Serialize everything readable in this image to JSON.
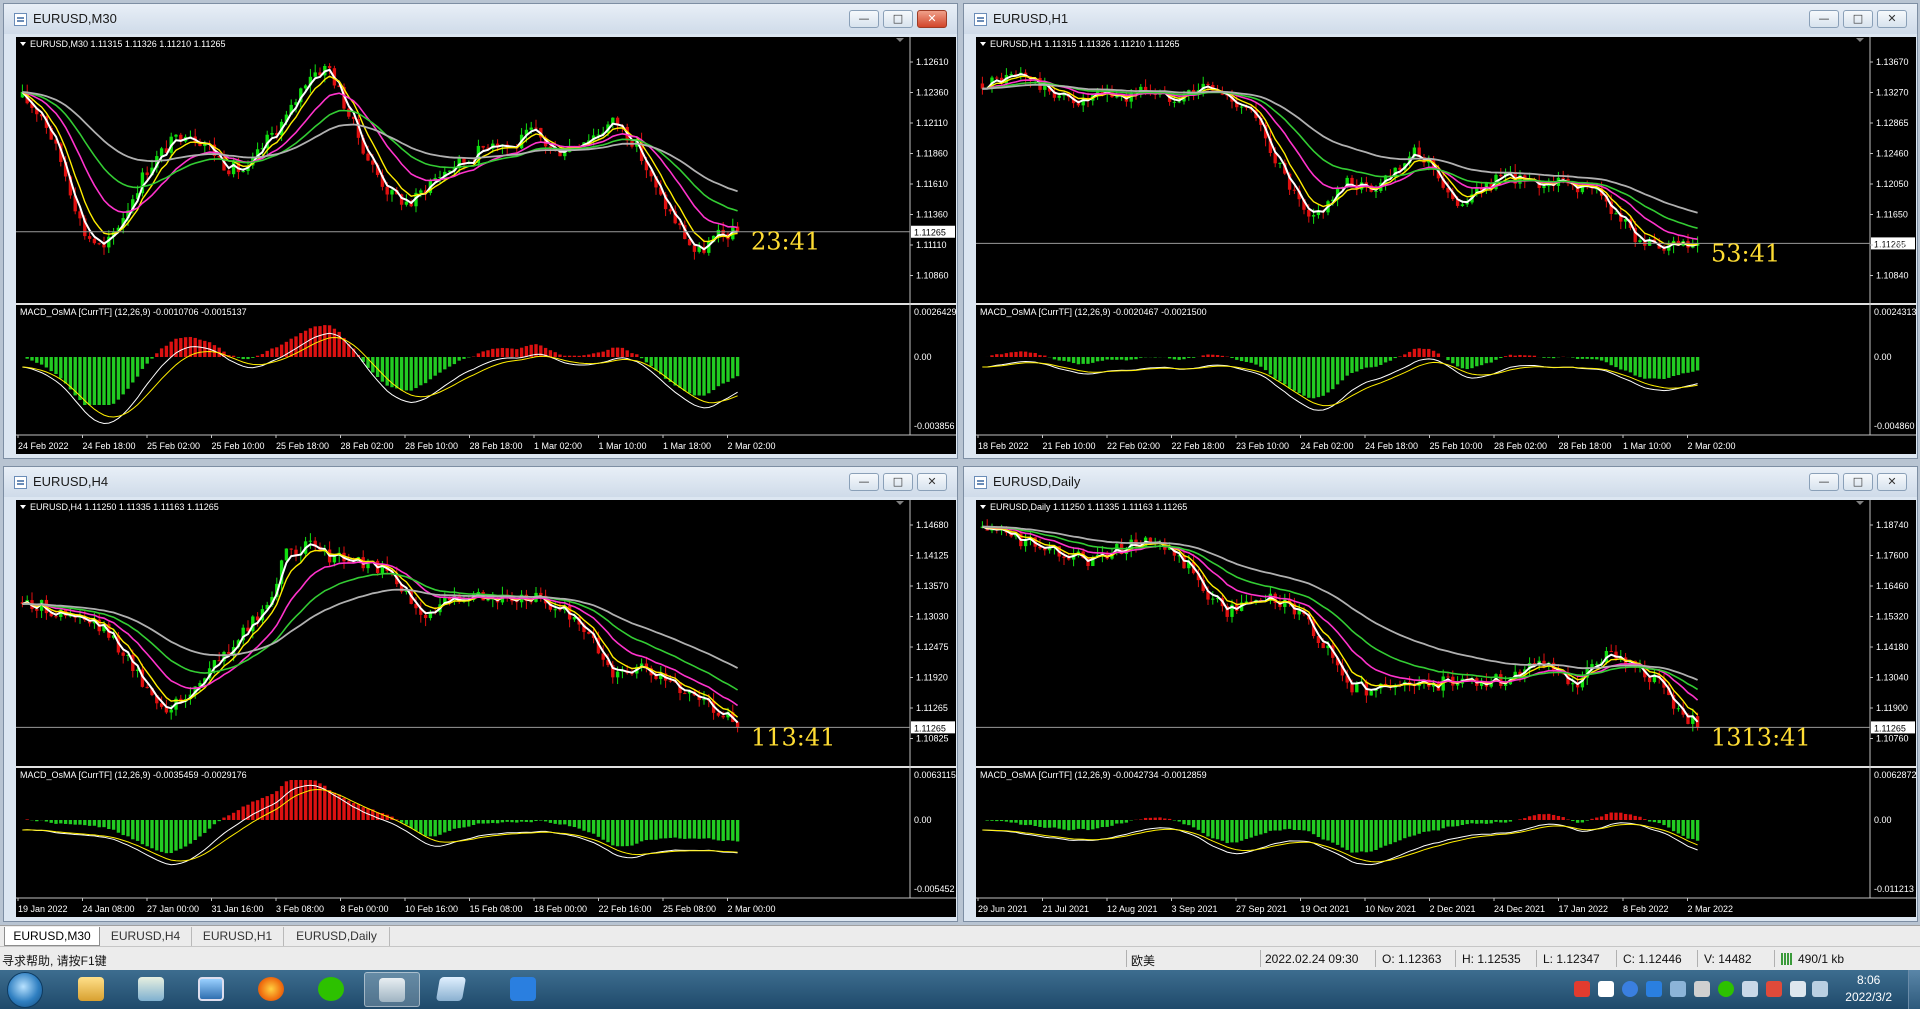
{
  "charts": [
    {
      "key": "m30",
      "title": "EURUSD,M30",
      "ohlc": "EURUSD,M30  1.11315 1.11326 1.11210 1.11265",
      "price_labels": [
        "1.12610",
        "1.12360",
        "1.12110",
        "1.11860",
        "1.11610",
        "1.11360",
        "1.11110",
        "1.10860"
      ],
      "current_price": "1.11265",
      "countdown": "23:41",
      "indicator": "MACD_OsMA [CurrTF] (12,26,9) -0.0010706 -0.0015137",
      "ind_labels": [
        "0.0026429",
        "0.00",
        "-0.003856"
      ],
      "time_labels": [
        "24 Feb 2022",
        "24 Feb 18:00",
        "25 Feb 02:00",
        "25 Feb 10:00",
        "25 Feb 18:00",
        "28 Feb 02:00",
        "28 Feb 10:00",
        "28 Feb 18:00",
        "1 Mar 02:00",
        "1 Mar 10:00",
        "1 Mar 18:00",
        "2 Mar 02:00"
      ],
      "close_series": [
        0.8,
        0.72,
        0.5,
        0.22,
        0.14,
        0.3,
        0.48,
        0.58,
        0.66,
        0.6,
        0.5,
        0.48,
        0.62,
        0.72,
        0.9,
        0.93,
        0.72,
        0.52,
        0.38,
        0.34,
        0.44,
        0.5,
        0.54,
        0.62,
        0.58,
        0.66,
        0.56,
        0.6,
        0.64,
        0.7,
        0.6,
        0.4,
        0.26,
        0.12,
        0.2,
        0.22
      ]
    },
    {
      "key": "h1",
      "title": "EURUSD,H1",
      "ohlc": "EURUSD,H1  1.11315 1.11326 1.11210 1.11265",
      "price_labels": [
        "1.13670",
        "1.13270",
        "1.12865",
        "1.12460",
        "1.12050",
        "1.11650",
        "1.11245",
        "1.10840"
      ],
      "current_price": "1.11265",
      "countdown": "53:41",
      "indicator": "MACD_OsMA [CurrTF] (12,26,9) -0.0020467 -0.0021500",
      "ind_labels": [
        "0.0024313",
        "0.00",
        "-0.004860"
      ],
      "time_labels": [
        "18 Feb 2022",
        "21 Feb 10:00",
        "22 Feb 02:00",
        "22 Feb 18:00",
        "23 Feb 10:00",
        "24 Feb 02:00",
        "24 Feb 18:00",
        "25 Feb 10:00",
        "28 Feb 02:00",
        "28 Feb 18:00",
        "1 Mar 10:00",
        "2 Mar 02:00"
      ],
      "close_series": [
        0.86,
        0.88,
        0.9,
        0.84,
        0.8,
        0.78,
        0.82,
        0.8,
        0.84,
        0.8,
        0.82,
        0.85,
        0.8,
        0.76,
        0.6,
        0.42,
        0.26,
        0.36,
        0.44,
        0.4,
        0.48,
        0.56,
        0.52,
        0.34,
        0.38,
        0.44,
        0.46,
        0.42,
        0.44,
        0.42,
        0.4,
        0.3,
        0.2,
        0.14,
        0.16,
        0.15
      ]
    },
    {
      "key": "h4",
      "title": "EURUSD,H4",
      "ohlc": "EURUSD,H4  1.11250 1.11335 1.11163 1.11265",
      "price_labels": [
        "1.14680",
        "1.14125",
        "1.13570",
        "1.13030",
        "1.12475",
        "1.11920",
        "1.11265",
        "1.10825"
      ],
      "current_price": "1.11265",
      "countdown": "113:41",
      "indicator": "MACD_OsMA [CurrTF] (12,26,9) -0.0035459 -0.0029176",
      "ind_labels": [
        "0.0063115",
        "0.00",
        "-0.005452"
      ],
      "time_labels": [
        "19 Jan 2022",
        "24 Jan 08:00",
        "27 Jan 00:00",
        "31 Jan 16:00",
        "3 Feb 08:00",
        "8 Feb 00:00",
        "10 Feb 16:00",
        "15 Feb 08:00",
        "18 Feb 00:00",
        "22 Feb 16:00",
        "25 Feb 08:00",
        "2 Mar 00:00"
      ],
      "close_series": [
        0.62,
        0.6,
        0.56,
        0.54,
        0.5,
        0.4,
        0.26,
        0.16,
        0.2,
        0.32,
        0.4,
        0.5,
        0.62,
        0.84,
        0.86,
        0.82,
        0.8,
        0.78,
        0.74,
        0.62,
        0.56,
        0.64,
        0.66,
        0.64,
        0.62,
        0.64,
        0.6,
        0.56,
        0.44,
        0.3,
        0.34,
        0.3,
        0.26,
        0.22,
        0.16,
        0.1
      ]
    },
    {
      "key": "daily",
      "title": "EURUSD,Daily",
      "ohlc": "EURUSD,Daily  1.11250 1.11335 1.11163 1.11265",
      "price_labels": [
        "1.18740",
        "1.17600",
        "1.16460",
        "1.15320",
        "1.14180",
        "1.13040",
        "1.11900",
        "1.10760"
      ],
      "current_price": "1.11265",
      "countdown": "1313:41",
      "indicator": "MACD_OsMA [CurrTF] (12,26,9) -0.0042734 -0.0012859",
      "ind_labels": [
        "0.0062872",
        "0.00",
        "-0.011213"
      ],
      "time_labels": [
        "29 Jun 2021",
        "21 Jul 2021",
        "12 Aug 2021",
        "3 Sep 2021",
        "27 Sep 2021",
        "19 Oct 2021",
        "10 Nov 2021",
        "2 Dec 2021",
        "24 Dec 2021",
        "17 Jan 2022",
        "8 Feb 2022",
        "2 Mar 2022"
      ],
      "close_series": [
        0.94,
        0.92,
        0.88,
        0.86,
        0.84,
        0.8,
        0.82,
        0.86,
        0.88,
        0.84,
        0.78,
        0.66,
        0.58,
        0.62,
        0.64,
        0.6,
        0.52,
        0.4,
        0.26,
        0.24,
        0.26,
        0.27,
        0.26,
        0.28,
        0.29,
        0.28,
        0.3,
        0.38,
        0.32,
        0.24,
        0.36,
        0.4,
        0.34,
        0.28,
        0.16,
        0.08
      ]
    }
  ],
  "tabs": [
    "EURUSD,M30",
    "EURUSD,H4",
    "EURUSD,H1",
    "EURUSD,Daily"
  ],
  "status": {
    "help": "寻求帮助, 请按F1键",
    "profile": "欧美",
    "datetime": "2022.02.24 09:30",
    "open": "O: 1.12363",
    "high": "H: 1.12535",
    "low": "L: 1.12347",
    "close": "C: 1.12446",
    "volume": "V: 14482",
    "traffic": "490/1 kb"
  },
  "clock": {
    "time": "8:06",
    "date": "2022/3/2"
  },
  "colors": {
    "bull": "#10e010",
    "bear": "#e01010",
    "price_text": "#ffffff",
    "ma_fast": "#ffffff",
    "ma_yellow": "#ffee00",
    "ma_magenta": "#ff33cc",
    "ma_green": "#33cc33",
    "ma_gray": "#b0b0b0",
    "countdown": "#ffdd33"
  }
}
